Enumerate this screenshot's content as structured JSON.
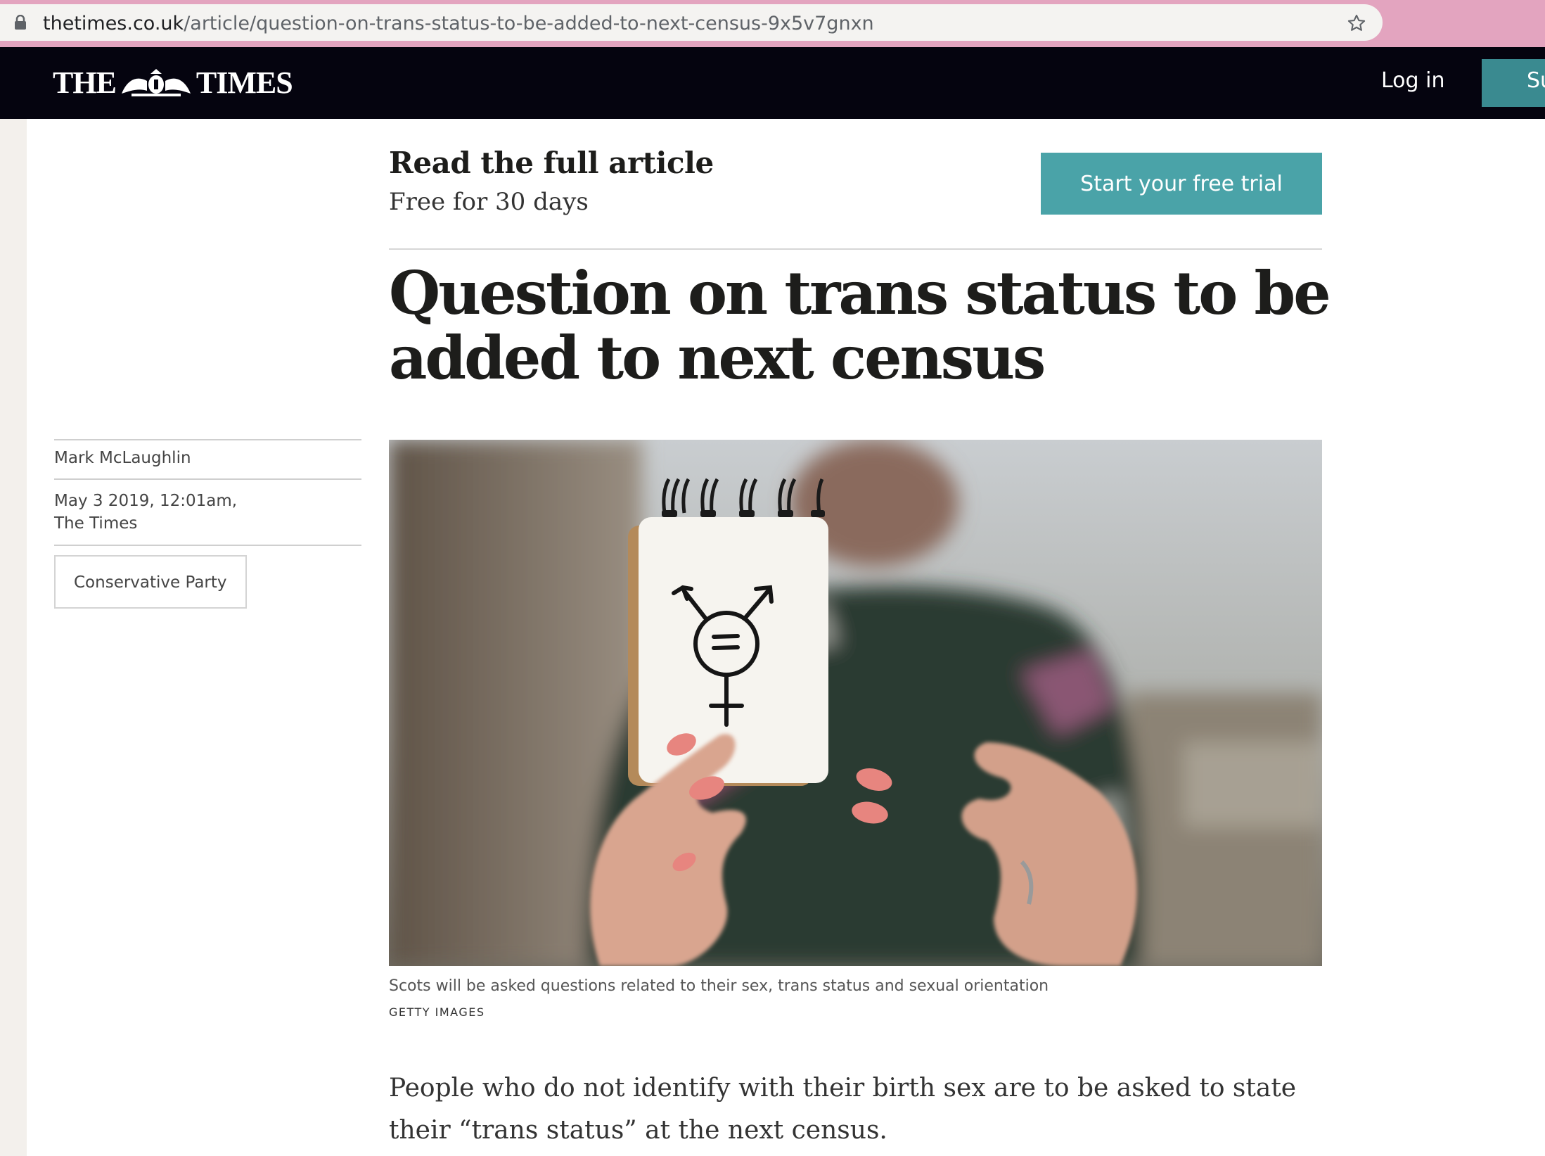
{
  "browser": {
    "url_domain": "thetimes.co.uk",
    "url_path": "/article/question-on-trans-status-to-be-added-to-next-census-9x5v7gnxn"
  },
  "header": {
    "logo_left": "THE",
    "logo_right": "TIMES",
    "login_label": "Log in",
    "subscribe_label": "Subscribe"
  },
  "cta": {
    "title": "Read the full article",
    "subtitle": "Free for 30 days",
    "button_label": "Start your free trial"
  },
  "article": {
    "headline": "Question on trans status to be added to next census",
    "author": "Mark McLaughlin",
    "date": "May 3 2019, 12:01am,",
    "publication": "The Times",
    "tag": "Conservative Party",
    "caption": "Scots will be asked questions related to their sex, trans status and sexual orientation",
    "credit": "GETTY IMAGES",
    "body": "People who do not identify with their birth sex are to be asked to state their “trans status” at the next census."
  },
  "colors": {
    "header_bg": "#05040f",
    "accent_teal": "#4aa3a8",
    "browser_frame": "#e3a4bf"
  }
}
